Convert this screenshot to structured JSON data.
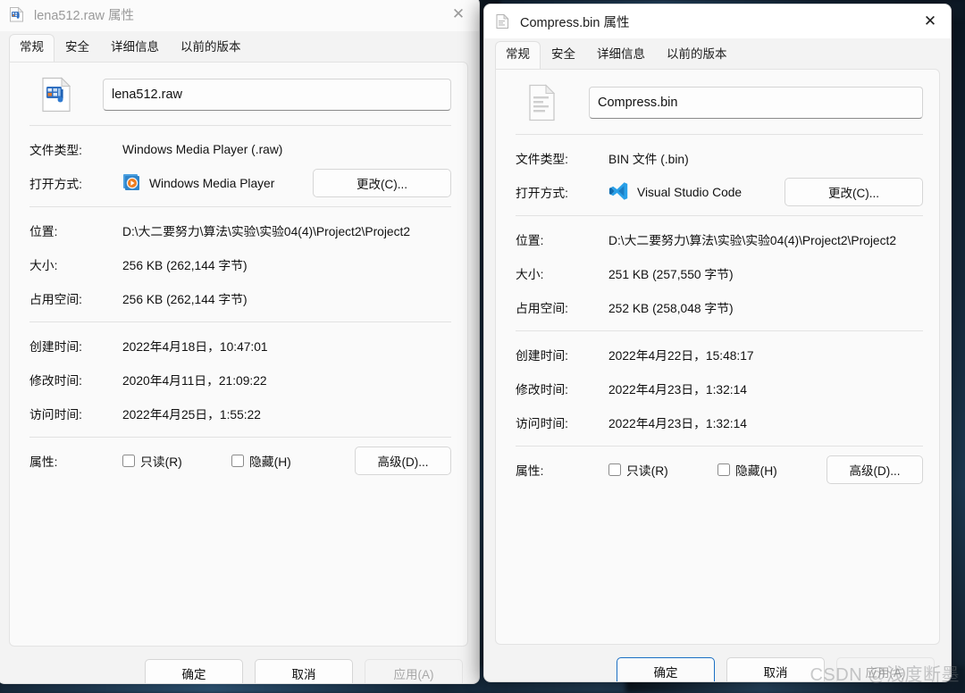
{
  "desktop": {
    "label": "desktop-wallpaper"
  },
  "watermark": "CSDN @浅度断墨",
  "tabs_labels": [
    "常规",
    "安全",
    "详细信息",
    "以前的版本"
  ],
  "field_labels": {
    "file_type": "文件类型:",
    "opens_with": "打开方式:",
    "location": "位置:",
    "size": "大小:",
    "size_on_disk": "占用空间:",
    "created": "创建时间:",
    "modified": "修改时间:",
    "accessed": "访问时间:",
    "attributes": "属性:"
  },
  "buttons": {
    "change": "更改(C)...",
    "advanced": "高级(D)...",
    "ok": "确定",
    "cancel": "取消",
    "apply": "应用(A)"
  },
  "checkboxes": {
    "readonly": "只读(R)",
    "hidden": "隐藏(H)"
  },
  "left_window": {
    "title": "lena512.raw 属性",
    "title_icon": "media-file-icon",
    "close_icon": "close-icon",
    "active_tab_index": 0,
    "file_icon": "media-file-icon",
    "filename": "lena512.raw",
    "file_type": "Windows Media Player (.raw)",
    "open_with_app": "Windows Media Player",
    "open_with_icon": "windows-media-player-icon",
    "location": "D:\\大二要努力\\算法\\实验\\实验04(4)\\Project2\\Project2",
    "size": "256 KB (262,144 字节)",
    "size_on_disk": "256 KB (262,144 字节)",
    "created": "2022年4月18日，10:47:01",
    "modified": "2020年4月11日，21:09:22",
    "accessed": "2022年4月25日，1:55:22",
    "apply_enabled": false,
    "ok_primary": false
  },
  "right_window": {
    "title": "Compress.bin 属性",
    "title_icon": "generic-document-icon",
    "close_icon": "close-icon",
    "active_tab_index": 0,
    "file_icon": "generic-document-icon",
    "filename": "Compress.bin",
    "file_type": "BIN 文件 (.bin)",
    "open_with_app": "Visual Studio Code",
    "open_with_icon": "visual-studio-code-icon",
    "location": "D:\\大二要努力\\算法\\实验\\实验04(4)\\Project2\\Project2",
    "size": "251 KB (257,550 字节)",
    "size_on_disk": "252 KB (258,048 字节)",
    "created": "2022年4月22日，15:48:17",
    "modified": "2022年4月23日，1:32:14",
    "accessed": "2022年4月23日，1:32:14",
    "apply_enabled": false,
    "ok_primary": true
  }
}
